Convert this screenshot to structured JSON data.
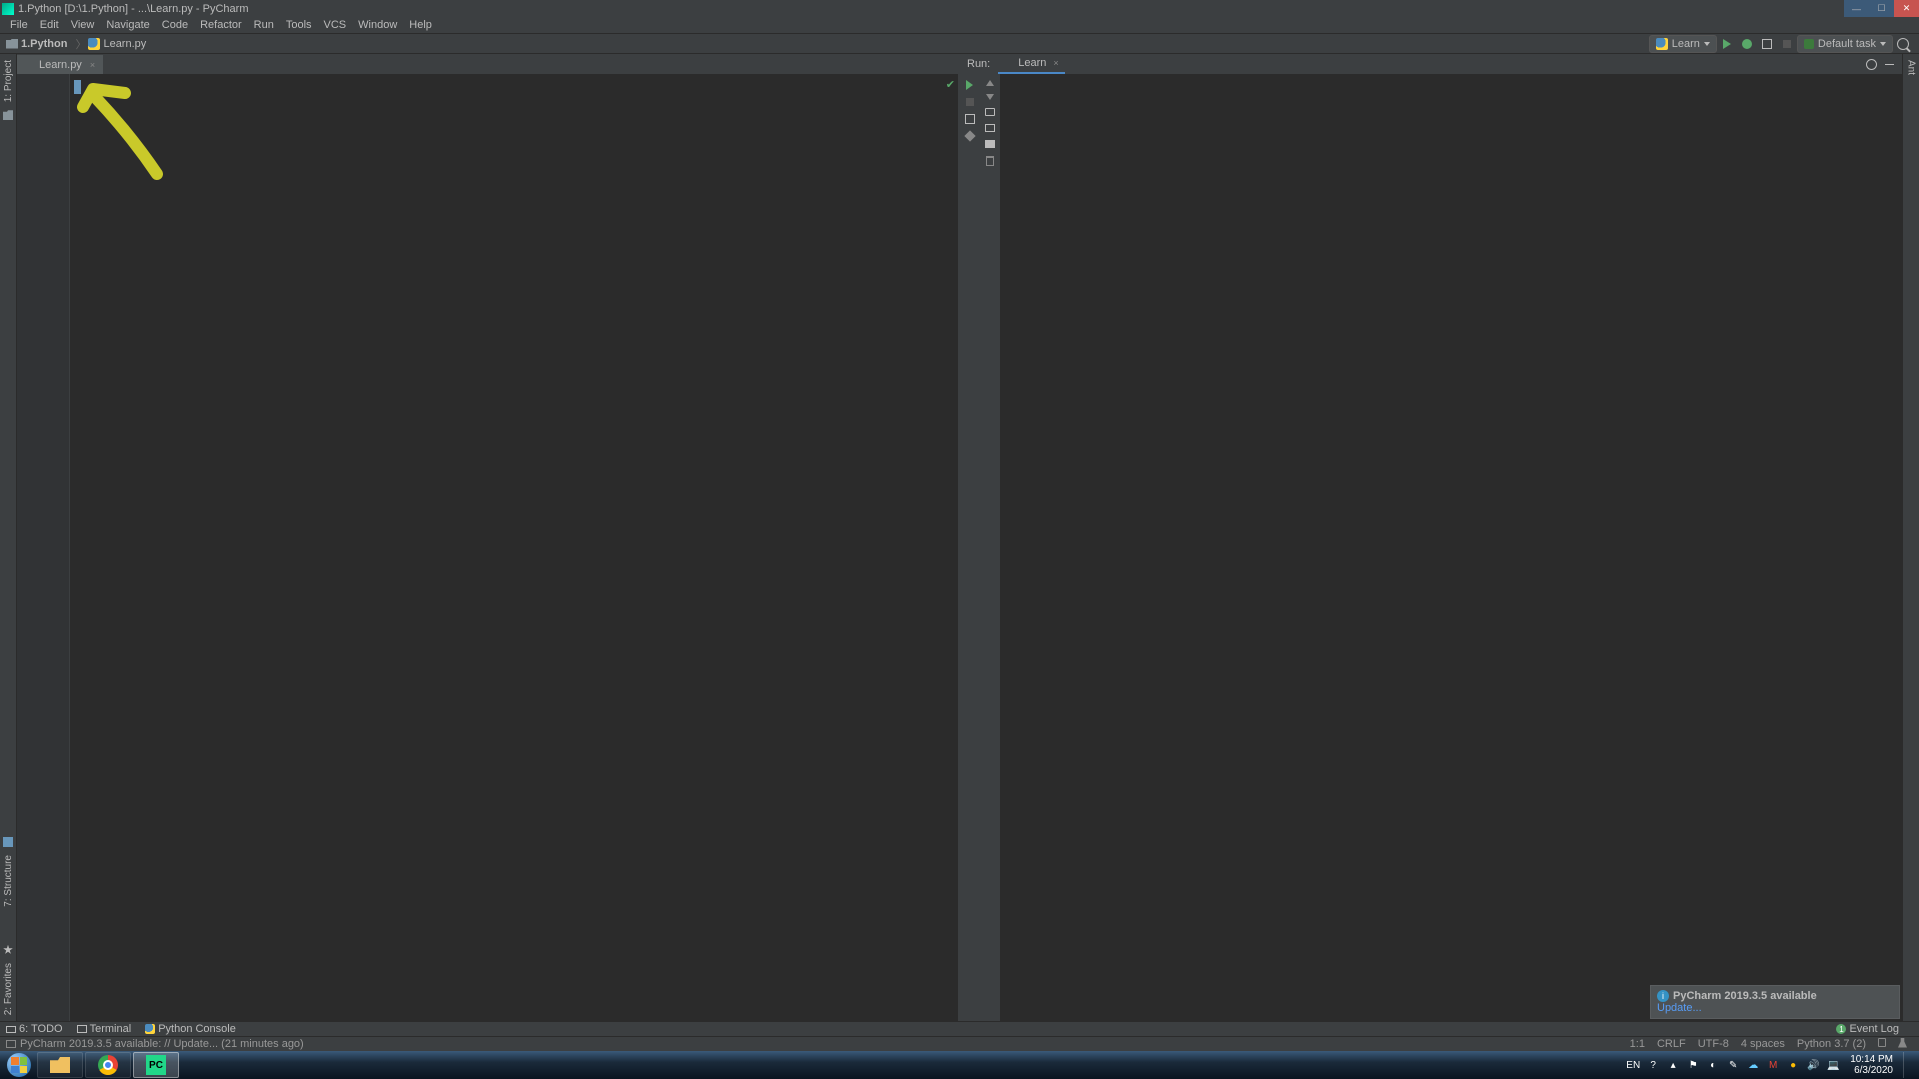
{
  "titlebar": {
    "text": "1.Python [D:\\1.Python] - ...\\Learn.py - PyCharm"
  },
  "menubar": [
    "File",
    "Edit",
    "View",
    "Navigate",
    "Code",
    "Refactor",
    "Run",
    "Tools",
    "VCS",
    "Window",
    "Help"
  ],
  "breadcrumb": {
    "project": "1.Python",
    "file": "Learn.py"
  },
  "run_config": {
    "label": "Learn"
  },
  "task_config": {
    "label": "Default task"
  },
  "editor": {
    "tab_label": "Learn.py"
  },
  "left_gutter": {
    "project": "1: Project",
    "structure": "7: Structure",
    "favorites": "2: Favorites"
  },
  "run_panel": {
    "header": "Run:",
    "tab": "Learn"
  },
  "right_gutter": {
    "ant": "Ant"
  },
  "bottom_tools": {
    "todo": "6: TODO",
    "terminal": "Terminal",
    "pyconsole": "Python Console",
    "event_log": "Event Log"
  },
  "status": {
    "message": "PyCharm 2019.3.5 available: // Update... (21 minutes ago)",
    "caret": "1:1",
    "lineend": "CRLF",
    "encoding": "UTF-8",
    "indent": "4 spaces",
    "interpreter": "Python 3.7 (2)"
  },
  "notif": {
    "title": "PyCharm 2019.3.5 available",
    "link": "Update..."
  },
  "taskbar": {
    "lang": "EN",
    "time": "10:14 PM",
    "date": "6/3/2020",
    "pycharm_badge": "PC"
  }
}
